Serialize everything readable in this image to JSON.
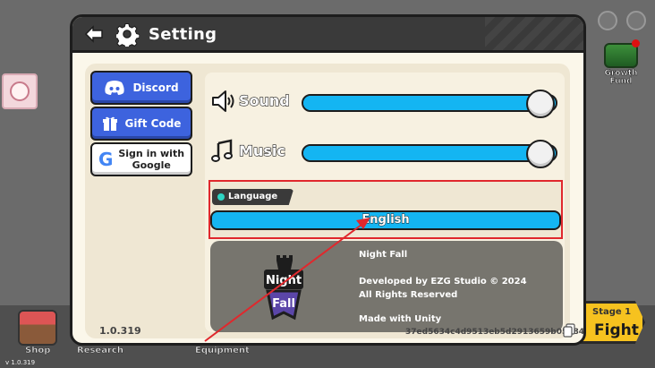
{
  "window": {
    "title": "Setting"
  },
  "side_buttons": {
    "discord": "Discord",
    "gift_code": "Gift Code",
    "google_line1": "Sign in with",
    "google_line2": "Google"
  },
  "settings": {
    "sound": {
      "label": "Sound",
      "level": 0.94
    },
    "music": {
      "label": "Music",
      "level": 0.94
    }
  },
  "language": {
    "tag": "Language",
    "selected": "English"
  },
  "info": {
    "game_name": "Night Fall",
    "developer": "Developed by EZG Studio © 2024",
    "rights": "All Rights Reserved",
    "engine": "Made with Unity",
    "logo_line1": "Night",
    "logo_line2": "Fall"
  },
  "footer": {
    "version": "1.0.319",
    "device_id": "37ed5634c4d9513eb5d2913659b05684"
  },
  "background": {
    "growth_fund": "Growth Fund",
    "shop": "Shop",
    "research": "Research",
    "equipment": "Equipment",
    "stage": "Stage 1",
    "fight": "Fight",
    "build_version": "v 1.0.319"
  },
  "colors": {
    "accent_blue": "#14b5f2",
    "button_blue": "#3d63de",
    "annotation_red": "#e0282d",
    "header_dark": "#3a3a3a"
  }
}
